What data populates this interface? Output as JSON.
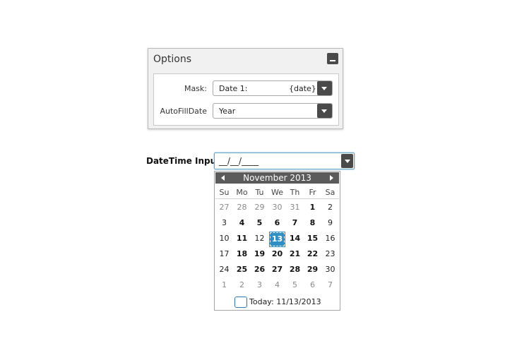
{
  "options": {
    "title": "Options",
    "mask": {
      "label": "Mask:",
      "value_left": "Date 1:",
      "value_right": "{date}"
    },
    "autofill": {
      "label": "AutoFillDate",
      "value": "Year"
    }
  },
  "datetime": {
    "label": "DateTime Input:",
    "value": "__/__/____"
  },
  "calendar": {
    "month_label": "November 2013",
    "weekdays": [
      "Su",
      "Mo",
      "Tu",
      "We",
      "Th",
      "Fr",
      "Sa"
    ],
    "weeks": [
      [
        "27",
        "28",
        "29",
        "30",
        "31",
        "1",
        "2"
      ],
      [
        "3",
        "4",
        "5",
        "6",
        "7",
        "8",
        "9"
      ],
      [
        "10",
        "11",
        "12",
        "13",
        "14",
        "15",
        "16"
      ],
      [
        "17",
        "18",
        "19",
        "20",
        "21",
        "22",
        "23"
      ],
      [
        "24",
        "25",
        "26",
        "27",
        "28",
        "29",
        "30"
      ],
      [
        "1",
        "2",
        "3",
        "4",
        "5",
        "6",
        "7"
      ]
    ],
    "selected_day": "13",
    "today_label": "Today: 11/13/2013",
    "accent_color": "#2f8fc4"
  }
}
